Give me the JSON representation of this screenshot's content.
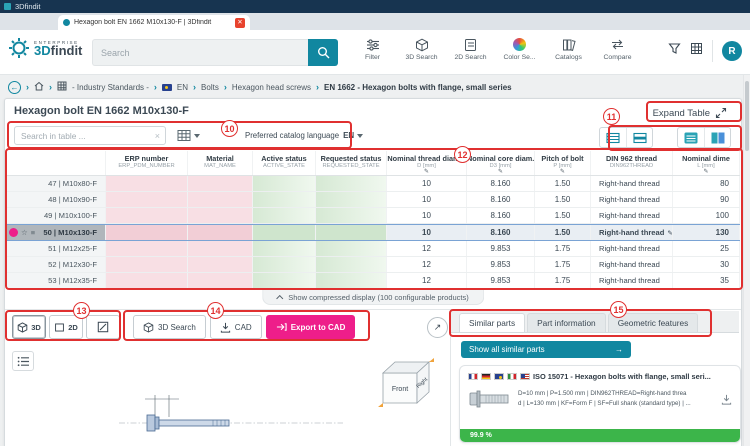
{
  "colors": {
    "teal": "#1187a0",
    "pink": "#ee1e8a",
    "annotation_red": "#e03030",
    "match_green": "#3cb54a"
  },
  "icons": {
    "back_arrow": "←",
    "chevron": "›",
    "clear": "×",
    "close": "✕",
    "pencil": "✎",
    "star": "☆",
    "menu": "≡",
    "arrow_right": "→",
    "popout_arrow": "↗"
  },
  "window": {
    "title": "3Dfindit",
    "tab_title": "Hexagon bolt EN 1662 M10x130-F | 3Dfindit"
  },
  "header": {
    "logo": {
      "enterprise": "ENTERPRISE",
      "brand_3d": "3D",
      "brand_rest": "findit"
    },
    "search_placeholder": "Search",
    "tools": [
      {
        "label": "Filter"
      },
      {
        "label": "3D Search"
      },
      {
        "label": "2D Search"
      },
      {
        "label": "Color Se..."
      },
      {
        "label": "Catalogs"
      },
      {
        "label": "Compare"
      }
    ],
    "avatar": "R"
  },
  "breadcrumb": {
    "items": [
      "- Industry Standards -",
      "EN",
      "Bolts",
      "Hexagon head screws",
      "EN 1662 - Hexagon bolts with flange, small series"
    ]
  },
  "page": {
    "title": "Hexagon bolt EN 1662 M10x130-F",
    "expand_label": "Expand Table"
  },
  "table_toolbar": {
    "search_placeholder": "Search in table ...",
    "language_label": "Preferred catalog language",
    "language_value": "EN"
  },
  "table": {
    "columns": [
      {
        "title": "ERP number",
        "sub": "ERP_PDM_NUMBER"
      },
      {
        "title": "Material",
        "sub": "MAT_NAME"
      },
      {
        "title": "Active status",
        "sub": "ACTIVE_STATE"
      },
      {
        "title": "Requested status",
        "sub": "REQUESTED_STATE"
      },
      {
        "title": "Nominal thread diam...",
        "sub": "D [mm]"
      },
      {
        "title": "Nominal core diam...",
        "sub": "D3 [mm]"
      },
      {
        "title": "Pitch of bolt",
        "sub": "P [mm]"
      },
      {
        "title": "DIN 962 thread",
        "sub": "DIN962THREAD"
      },
      {
        "title": "Nominal dime",
        "sub": "L [mm]"
      }
    ],
    "rows": [
      {
        "num": "47 | M10x80-F",
        "d": "10",
        "d3": "8.160",
        "p": "1.50",
        "thread": "Right-hand thread",
        "l": "80"
      },
      {
        "num": "48 | M10x90-F",
        "d": "10",
        "d3": "8.160",
        "p": "1.50",
        "thread": "Right-hand thread",
        "l": "90"
      },
      {
        "num": "49 | M10x100-F",
        "d": "10",
        "d3": "8.160",
        "p": "1.50",
        "thread": "Right-hand thread",
        "l": "100"
      },
      {
        "num": "50 | M10x130-F",
        "d": "10",
        "d3": "8.160",
        "p": "1.50",
        "thread": "Right-hand thread",
        "l": "130"
      },
      {
        "num": "51 | M12x25-F",
        "d": "12",
        "d3": "9.853",
        "p": "1.75",
        "thread": "Right-hand thread",
        "l": "25"
      },
      {
        "num": "52 | M12x30-F",
        "d": "12",
        "d3": "9.853",
        "p": "1.75",
        "thread": "Right-hand thread",
        "l": "30"
      },
      {
        "num": "53 | M12x35-F",
        "d": "12",
        "d3": "9.853",
        "p": "1.75",
        "thread": "Right-hand thread",
        "l": "35"
      }
    ],
    "compressed_label": "Show compressed display (100 configurable products)"
  },
  "viewer": {
    "view_3d": "3D",
    "view_2d": "2D",
    "search_3d": "3D Search",
    "cad": "CAD",
    "export": "Export to CAD",
    "cube_front": "Front",
    "cube_right": "Right"
  },
  "side_panel": {
    "tabs": [
      {
        "label": "Similar parts"
      },
      {
        "label": "Part information"
      },
      {
        "label": "Geometric features"
      }
    ],
    "show_all": "Show all similar parts",
    "card": {
      "title": "ISO 15071 - Hexagon bolts with flange, small seri...",
      "attrs_line1": "D=10 mm | P=1.500 mm | DIN962THREAD=Right-hand threa",
      "attrs_line2": "d | L=130 mm | KF=Form F | SF=Full shank (standard type) | ...",
      "match": "99.9 %"
    }
  },
  "annotations": {
    "n10": "10",
    "n11": "11",
    "n12": "12",
    "n13": "13",
    "n14": "14",
    "n15": "15"
  }
}
